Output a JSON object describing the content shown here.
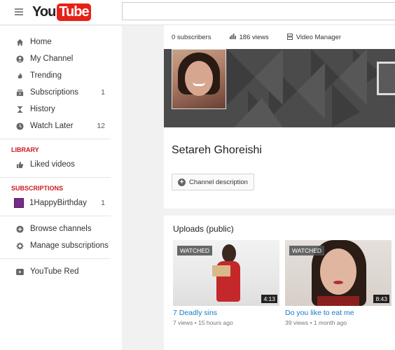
{
  "header": {
    "logo_you": "You",
    "logo_tube": "Tube",
    "search_placeholder": ""
  },
  "sidebar": {
    "items": [
      {
        "label": "Home",
        "icon": "home-icon"
      },
      {
        "label": "My Channel",
        "icon": "person-icon"
      },
      {
        "label": "Trending",
        "icon": "flame-icon"
      },
      {
        "label": "Subscriptions",
        "icon": "subscriptions-icon",
        "count": "1"
      },
      {
        "label": "History",
        "icon": "hourglass-icon"
      },
      {
        "label": "Watch Later",
        "icon": "clock-icon",
        "count": "12"
      }
    ],
    "library_heading": "LIBRARY",
    "library_items": [
      {
        "label": "Liked videos",
        "icon": "thumbs-up-icon"
      }
    ],
    "subscriptions_heading": "SUBSCRIPTIONS",
    "subscription_items": [
      {
        "label": "1HappyBirthday",
        "count": "1"
      }
    ],
    "bottom_items": [
      {
        "label": "Browse channels",
        "icon": "plus-circle-icon"
      },
      {
        "label": "Manage subscriptions",
        "icon": "gear-icon"
      },
      {
        "label": "YouTube Red",
        "icon": "youtube-red-icon"
      }
    ]
  },
  "channel": {
    "subscribers": "0 subscribers",
    "views": "186 views",
    "video_manager": "Video Manager",
    "name": "Setareh Ghoreishi",
    "description_button": "Channel description"
  },
  "uploads": {
    "title": "Uploads (public)",
    "videos": [
      {
        "title": "7 Deadly sins",
        "views": "7 views",
        "age": "15 hours ago",
        "duration": "4:13",
        "badge": "WATCHED"
      },
      {
        "title": "Do you like to eat me",
        "views": "39 views",
        "age": "1 month ago",
        "duration": "8:43",
        "badge": "WATCHED"
      }
    ],
    "meta_separator": "•"
  },
  "colors": {
    "brand_red": "#e62117",
    "link_blue": "#167ac6",
    "section_heading_red": "#cc181e"
  }
}
